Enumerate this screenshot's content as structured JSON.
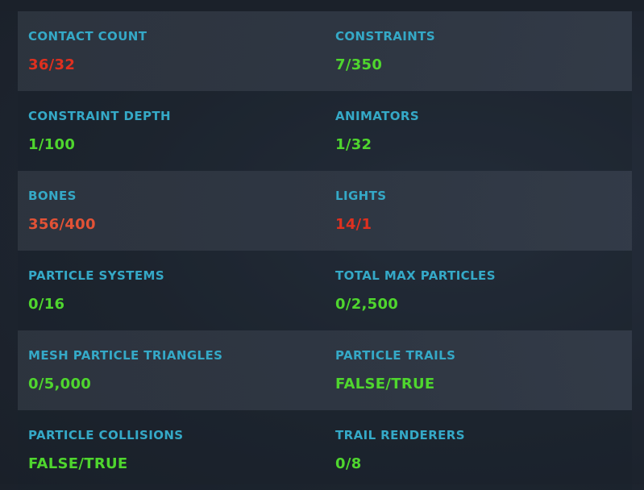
{
  "colors": {
    "label": "#35a9c7",
    "ok": "#4fd62e",
    "bad": "#e0301f",
    "warn": "#e25236"
  },
  "rows": [
    {
      "left": {
        "label": "CONTACT COUNT",
        "value": "36/32",
        "status": "bad"
      },
      "right": {
        "label": "CONSTRAINTS",
        "value": "7/350",
        "status": "ok"
      }
    },
    {
      "left": {
        "label": "CONSTRAINT DEPTH",
        "value": "1/100",
        "status": "ok"
      },
      "right": {
        "label": "ANIMATORS",
        "value": "1/32",
        "status": "ok"
      }
    },
    {
      "left": {
        "label": "BONES",
        "value": "356/400",
        "status": "warn"
      },
      "right": {
        "label": "LIGHTS",
        "value": "14/1",
        "status": "bad"
      }
    },
    {
      "left": {
        "label": "PARTICLE SYSTEMS",
        "value": "0/16",
        "status": "ok"
      },
      "right": {
        "label": "TOTAL MAX PARTICLES",
        "value": "0/2,500",
        "status": "ok"
      }
    },
    {
      "left": {
        "label": "MESH PARTICLE TRIANGLES",
        "value": "0/5,000",
        "status": "ok"
      },
      "right": {
        "label": "PARTICLE TRAILS",
        "value": "FALSE/TRUE",
        "status": "ok"
      }
    },
    {
      "left": {
        "label": "PARTICLE COLLISIONS",
        "value": "FALSE/TRUE",
        "status": "ok"
      },
      "right": {
        "label": "TRAIL RENDERERS",
        "value": "0/8",
        "status": "ok"
      }
    }
  ]
}
